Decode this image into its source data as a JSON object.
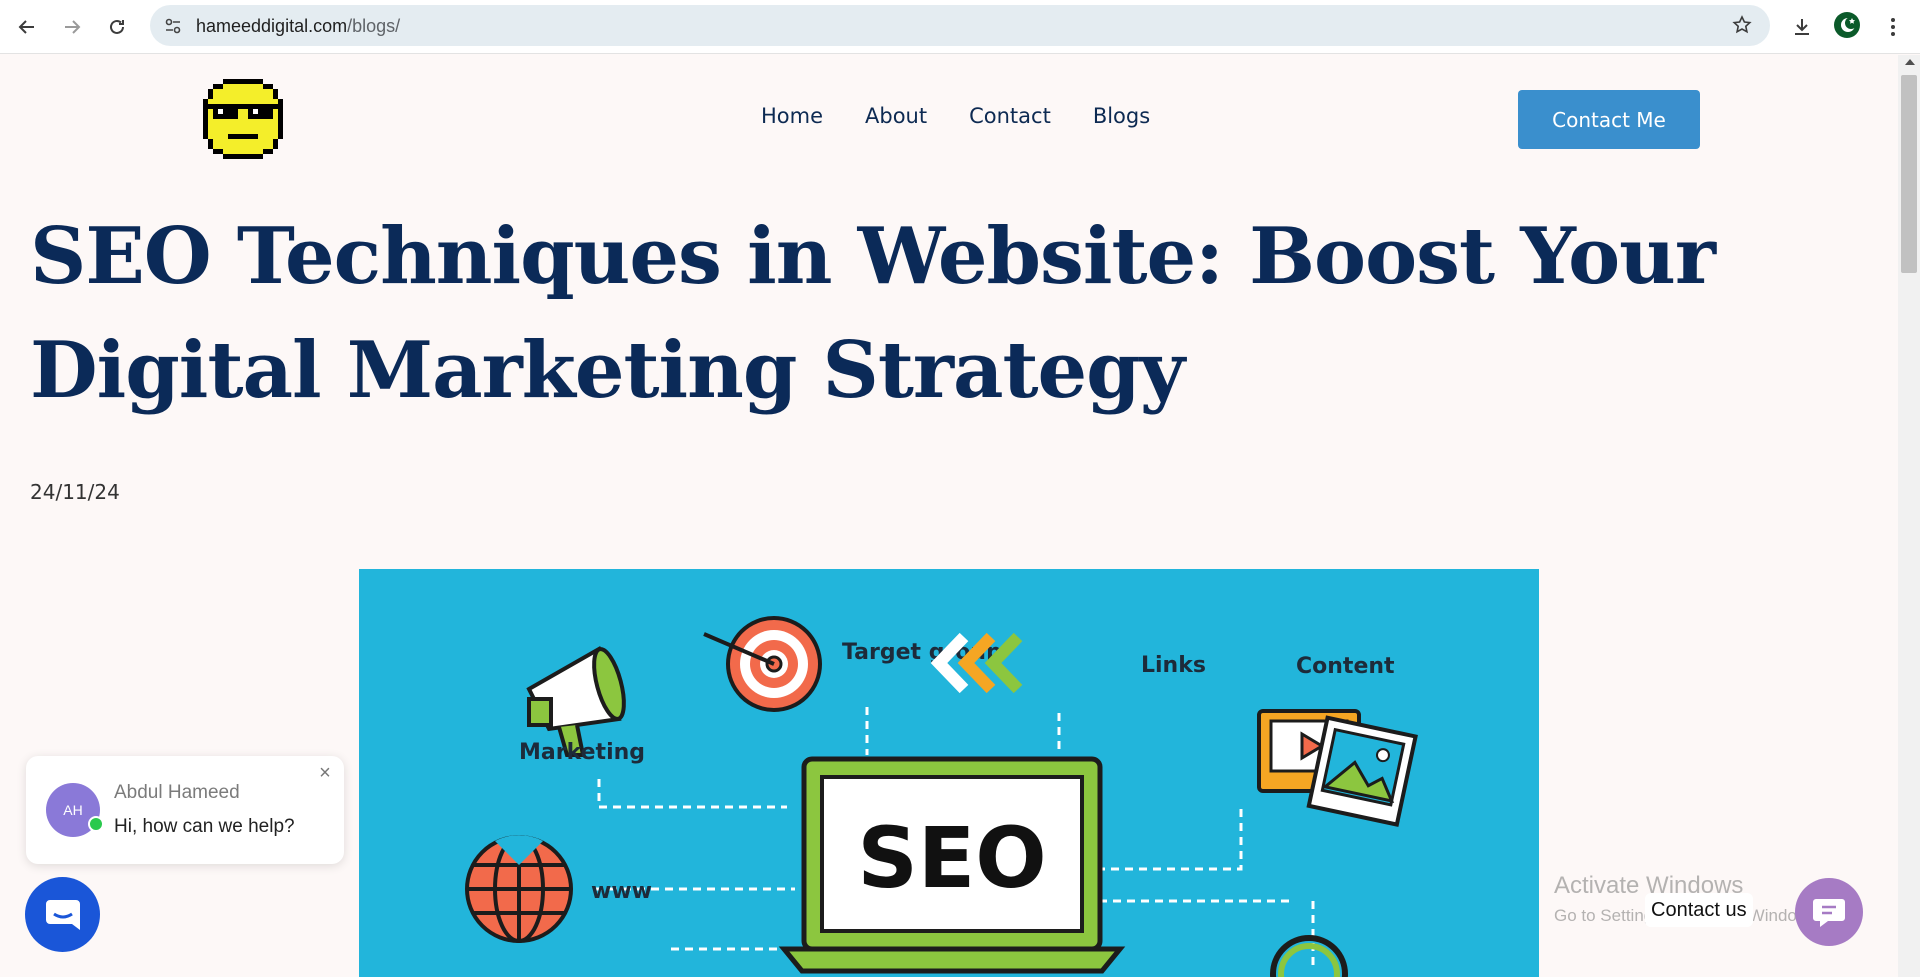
{
  "browser": {
    "url_host": "hameeddigital.com",
    "url_path": "/blogs/",
    "icons": [
      "back-icon",
      "forward-icon",
      "reload-icon",
      "site-info-icon",
      "bookmark-star-icon",
      "download-icon",
      "profile-avatar",
      "menu-dots-icon"
    ]
  },
  "site": {
    "nav": [
      "Home",
      "About",
      "Contact",
      "Blogs"
    ],
    "cta_label": "Contact Me",
    "accent": "#3a8fcd",
    "title_color": "#0b2a58"
  },
  "post": {
    "title": "SEO Techniques in Website: Boost Your Digital Marketing Strategy",
    "date": "24/11/24",
    "image": {
      "background": "#22b5db",
      "labels": {
        "marketing": "Marketing",
        "target_group": "Target group",
        "links": "Links",
        "content": "Content",
        "www": "www",
        "seo": "SEO"
      }
    }
  },
  "chat": {
    "avatar_initials": "AH",
    "name": "Abdul Hameed",
    "message": "Hi, how can we help?"
  },
  "watermark": {
    "line1": "Activate Windows",
    "line2": "Go to Settings to activate Windows."
  },
  "contact_widget": {
    "label": "Contact us"
  }
}
